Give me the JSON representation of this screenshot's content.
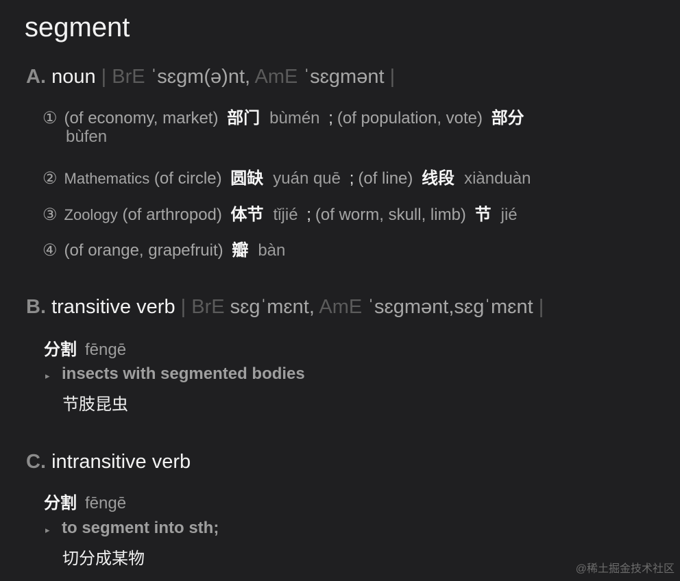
{
  "headword": "segment",
  "sections": {
    "a": {
      "letter": "A.",
      "pos": "noun",
      "sep_open": " | ",
      "bre": "BrE",
      "bre_pron": "ˈsɛɡm(ə)nt,",
      "ame": "AmE",
      "ame_pron": "ˈsɛɡmənt",
      "sep_close": " |",
      "senses": [
        {
          "num": "①",
          "gloss1": "(of economy, market)",
          "zh1": "部门",
          "py1": "bùmén",
          "semi": ";",
          "gloss2": "(of population, vote)",
          "zh2": "部分",
          "py2": "bùfen"
        },
        {
          "num": "②",
          "label": "Mathematics",
          "gloss1": "(of circle)",
          "zh1": "圆缺",
          "py1": "yuán quē",
          "semi": ";",
          "gloss2": "(of line)",
          "zh2": "线段",
          "py2": "xiànduàn"
        },
        {
          "num": "③",
          "label": "Zoology",
          "gloss1": "(of arthropod)",
          "zh1": "体节",
          "py1": "tǐjié",
          "semi": ";",
          "gloss2": "(of worm, skull, limb)",
          "zh2": "节",
          "py2": "jié"
        },
        {
          "num": "④",
          "gloss1": "(of orange, grapefruit)",
          "zh1": "瓣",
          "py1": "bàn"
        }
      ]
    },
    "b": {
      "letter": "B.",
      "pos": "transitive verb",
      "sep_open": " | ",
      "bre": "BrE",
      "bre_pron": "sɛɡˈmɛnt,",
      "ame": "AmE",
      "ame_pron": "ˈsɛɡmənt,sɛɡˈmɛnt",
      "sep_close": " |",
      "zh": "分割",
      "py": "fēngē",
      "example_en": "insects with segmented bodies",
      "example_zh": "节肢昆虫"
    },
    "c": {
      "letter": "C.",
      "pos": "intransitive verb",
      "zh": "分割",
      "py": "fēngē",
      "example_en": "to segment into sth;",
      "example_zh": "切分成某物"
    }
  },
  "triangle": "▸",
  "watermark": "@稀土掘金技术社区"
}
